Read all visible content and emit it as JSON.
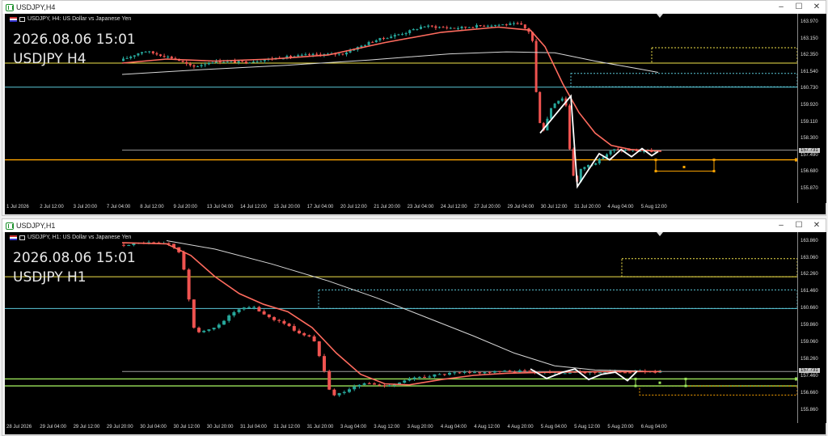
{
  "chart_data": [
    {
      "type": "candlestick",
      "window_title": "USDJPY,H4",
      "header": "USDJPY, H4:  US Dollar vs Japanese Yen",
      "overlay_date": "2026.08.06 15:01",
      "overlay_symbol": "USDJPY H4",
      "price_ticks": [
        "163.970",
        "163.150",
        "162.350",
        "161.540",
        "160.730",
        "159.920",
        "159.110",
        "158.300",
        "157.490",
        "156.680",
        "155.870"
      ],
      "current_price_tag": "157.731",
      "time_ticks": [
        "1 Jul 2026",
        "2 Jul 12:00",
        "3 Jul 20:00",
        "7 Jul 04:00",
        "8 Jul 12:00",
        "9 Jul 20:00",
        "13 Jul 04:00",
        "14 Jul 12:00",
        "15 Jul 20:00",
        "17 Jul 04:00",
        "20 Jul 12:00",
        "21 Jul 20:00",
        "23 Jul 04:00",
        "24 Jul 12:00",
        "27 Jul 20:00",
        "29 Jul 04:00",
        "30 Jul 12:00",
        "31 Jul 20:00",
        "4 Aug 04:00",
        "5 Aug 12:00"
      ],
      "ylim": [
        155.2,
        164.4
      ],
      "colors": {
        "bull": "#26a69a",
        "bear": "#ef5350",
        "ma_fast": "#ff6b5e",
        "ma_slow": "#d8d8d8",
        "zigzag": "#ffffff",
        "support": "#ffa500",
        "resistance": "#f2e34a",
        "level": "#5bc8d8",
        "gray_level": "#9a9a9a"
      },
      "horizontal_lines": [
        {
          "price": 162.0,
          "color": "#f2e34a"
        },
        {
          "price": 160.83,
          "color": "#5bc8d8"
        },
        {
          "price": 157.77,
          "color": "#9a9a9a"
        },
        {
          "price": 157.3,
          "color": "#ffa500"
        }
      ]
    },
    {
      "type": "candlestick",
      "window_title": "USDJPY,H1",
      "header": "USDJPY, H1:  US Dollar vs Japanese Yen",
      "overlay_date": "2026.08.06 15:01",
      "overlay_symbol": "USDJPY H1",
      "price_ticks": [
        "163.860",
        "163.060",
        "162.260",
        "161.460",
        "160.660",
        "159.860",
        "159.060",
        "158.260",
        "157.460",
        "156.660",
        "155.860"
      ],
      "current_price_tag": "157.731",
      "time_ticks": [
        "28 Jul 2026",
        "29 Jul 04:00",
        "29 Jul 12:00",
        "29 Jul 20:00",
        "30 Jul 04:00",
        "30 Jul 12:00",
        "30 Jul 20:00",
        "31 Jul 04:00",
        "31 Jul 12:00",
        "31 Jul 20:00",
        "3 Aug 04:00",
        "3 Aug 12:00",
        "3 Aug 20:00",
        "4 Aug 04:00",
        "4 Aug 12:00",
        "4 Aug 20:00",
        "5 Aug 04:00",
        "5 Aug 12:00",
        "5 Aug 20:00",
        "6 Aug 04:00"
      ],
      "ylim": [
        155.3,
        164.3
      ],
      "colors": {
        "bull": "#26a69a",
        "bear": "#ef5350",
        "ma_fast": "#ff6b5e",
        "ma_slow": "#d8d8d8",
        "zigzag": "#ffffff",
        "support": "#9be35a",
        "resistance": "#f2e34a",
        "level": "#5bc8d8",
        "gray_level": "#9a9a9a"
      },
      "horizontal_lines": [
        {
          "price": 162.2,
          "color": "#f2e34a"
        },
        {
          "price": 160.7,
          "color": "#5bc8d8"
        },
        {
          "price": 157.73,
          "color": "#9a9a9a"
        },
        {
          "price": 157.38,
          "color": "#9be35a"
        },
        {
          "price": 157.05,
          "color": "#9be35a"
        }
      ]
    }
  ]
}
